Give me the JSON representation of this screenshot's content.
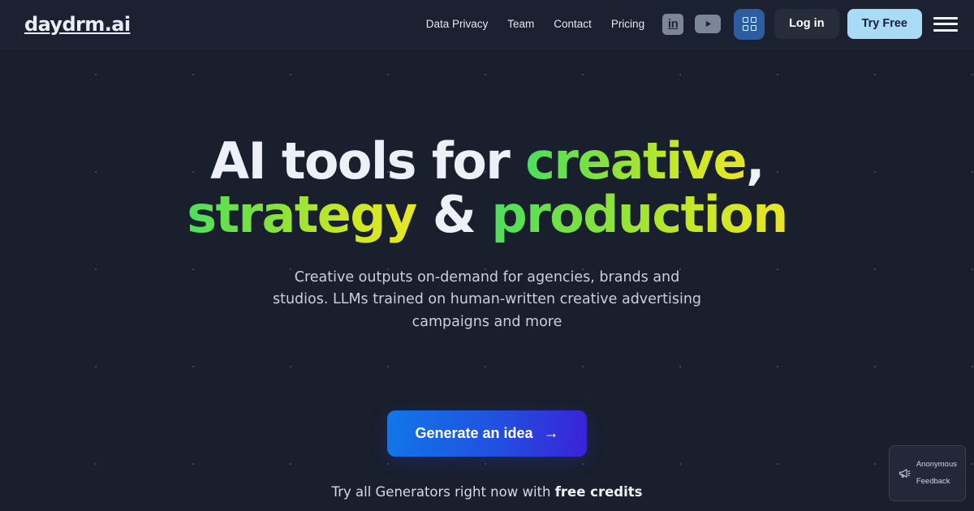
{
  "site": {
    "brand": "daydrm.ai"
  },
  "header": {
    "nav": [
      {
        "label": "Data Privacy",
        "name": "nav-link-data-privacy"
      },
      {
        "label": "Team",
        "name": "nav-link-team"
      },
      {
        "label": "Contact",
        "name": "nav-link-contact"
      },
      {
        "label": "Pricing",
        "name": "nav-link-pricing"
      }
    ],
    "social": [
      {
        "label": "in",
        "icon": "linkedin-icon"
      },
      {
        "label": "",
        "icon": "youtube-icon"
      }
    ],
    "apps_icon": "grid-apps-icon",
    "login_label": "Log in",
    "tryfree_label": "Try Free",
    "menu_icon": "hamburger-menu-icon"
  },
  "hero": {
    "headline": {
      "part1": "AI tools for ",
      "accent1": "creative",
      "comma": ",",
      "accent2": "strategy",
      "amp": " & ",
      "accent3": "production"
    },
    "subhead": "Creative outputs on-demand for agencies, brands and studios. LLMs trained on human-written creative advertising campaigns and more",
    "cta_label": "Generate an idea",
    "cta_arrow": "→",
    "credits_prefix": "Try all Generators right now with ",
    "credits_bold": "free credits"
  },
  "feedback": {
    "line1": "Anonymous",
    "line2": "Feedback",
    "icon": "megaphone-icon"
  },
  "colors": {
    "background": "#1a1f2d",
    "header_background": "#1b2130",
    "accent_green": "#4ade60",
    "accent_yellow": "#eae526",
    "cta_blue": "#1177e8",
    "cta_purple": "#3a22d8",
    "tryfree_blue": "#a9dbf7",
    "apps_blue": "#2d5d9e"
  }
}
